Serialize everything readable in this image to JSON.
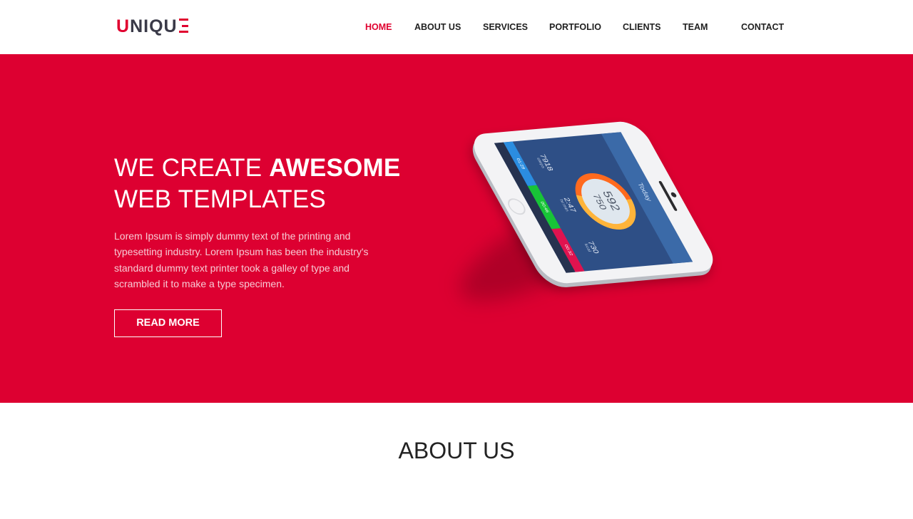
{
  "header": {
    "logo": {
      "part_red": "U",
      "part_dark": "NIQU",
      "accent_color": "#e0002f"
    },
    "nav": [
      {
        "label": "HOME",
        "active": true
      },
      {
        "label": "ABOUT US",
        "active": false
      },
      {
        "label": "SERVICES",
        "active": false
      },
      {
        "label": "PORTFOLIO",
        "active": false
      },
      {
        "label": "CLIENTS",
        "active": false
      },
      {
        "label": "TEAM",
        "active": false
      },
      {
        "label": "CONTACT",
        "active": false
      }
    ]
  },
  "hero": {
    "background_color": "#dd0031",
    "title_part1": "WE CREATE ",
    "title_bold": "AWESOME",
    "title_line2": "WEB TEMPLATES",
    "body": "Lorem Ipsum is simply dummy text of the printing and typesetting industry. Lorem Ipsum has been the industry's standard dummy text printer took a galley of type and scrambled it to make a type specimen.",
    "button_label": "READ MORE",
    "phone_screen": {
      "header": "Today",
      "ring_value_1": "592",
      "ring_value_2": "750",
      "stats": [
        {
          "value": "7918",
          "unit": "steps"
        },
        {
          "value": "2:47",
          "unit": "hr:min"
        },
        {
          "value": "730",
          "unit": "kcal"
        }
      ],
      "activity_times": [
        "01:29",
        "00:46",
        "00:32"
      ],
      "activity_colors": [
        "#2b8de0",
        "#18c437",
        "#e0134f"
      ]
    }
  },
  "about": {
    "title": "ABOUT US"
  }
}
